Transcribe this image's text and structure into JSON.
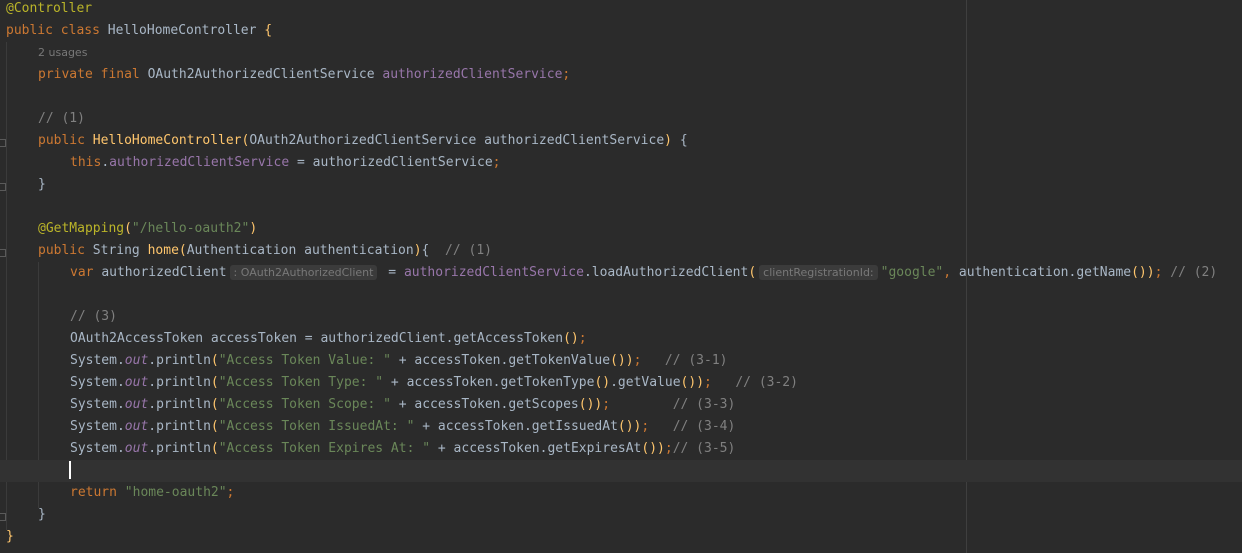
{
  "colors": {
    "background": "#2b2b2b",
    "current_line": "#323232",
    "keyword": "#cc7832",
    "annotation": "#bbb529",
    "string": "#6a8759",
    "comment": "#808080",
    "field": "#9876aa",
    "declaration": "#ffc66d",
    "default": "#a9b7c6"
  },
  "lines": [
    {
      "tokens": [
        {
          "t": "@Controller",
          "c": "annotation"
        }
      ]
    },
    {
      "tokens": [
        {
          "t": "public class ",
          "c": "keyword"
        },
        {
          "t": "HelloHomeController",
          "c": "default"
        },
        {
          "t": " {",
          "c": "paren"
        }
      ]
    },
    {
      "indent": 1,
      "usages": "2 usages",
      "tokens": []
    },
    {
      "indent": 1,
      "tokens": [
        {
          "t": "private final ",
          "c": "keyword"
        },
        {
          "t": "OAuth2AuthorizedClientService ",
          "c": "default"
        },
        {
          "t": "authorizedClientService",
          "c": "field"
        },
        {
          "t": ";",
          "c": "keyword"
        }
      ]
    },
    {
      "tokens": []
    },
    {
      "indent": 1,
      "tokens": [
        {
          "t": "// (1)",
          "c": "comment"
        }
      ]
    },
    {
      "indent": 1,
      "tokens": [
        {
          "t": "public ",
          "c": "keyword"
        },
        {
          "t": "HelloHomeController",
          "c": "decl"
        },
        {
          "t": "(",
          "c": "paren"
        },
        {
          "t": "OAuth2AuthorizedClientService authorizedClientService",
          "c": "default"
        },
        {
          "t": ")",
          "c": "paren"
        },
        {
          "t": " {",
          "c": "default"
        }
      ]
    },
    {
      "indent": 2,
      "tokens": [
        {
          "t": "this",
          "c": "keyword"
        },
        {
          "t": ".",
          "c": "default"
        },
        {
          "t": "authorizedClientService",
          "c": "field"
        },
        {
          "t": " = authorizedClientService",
          "c": "default"
        },
        {
          "t": ";",
          "c": "keyword"
        }
      ]
    },
    {
      "indent": 1,
      "tokens": [
        {
          "t": "}",
          "c": "default"
        }
      ]
    },
    {
      "tokens": []
    },
    {
      "indent": 1,
      "tokens": [
        {
          "t": "@GetMapping",
          "c": "annotation"
        },
        {
          "t": "(",
          "c": "paren"
        },
        {
          "t": "\"/hello-oauth2\"",
          "c": "string"
        },
        {
          "t": ")",
          "c": "paren"
        }
      ]
    },
    {
      "indent": 1,
      "tokens": [
        {
          "t": "public ",
          "c": "keyword"
        },
        {
          "t": "String ",
          "c": "default"
        },
        {
          "t": "home",
          "c": "decl"
        },
        {
          "t": "(",
          "c": "paren"
        },
        {
          "t": "Authentication authentication",
          "c": "default"
        },
        {
          "t": ")",
          "c": "paren"
        },
        {
          "t": "{  ",
          "c": "default"
        },
        {
          "t": "// (1)",
          "c": "comment"
        }
      ]
    },
    {
      "indent": 2,
      "tokens": [
        {
          "t": "var ",
          "c": "keyword"
        },
        {
          "t": "authorizedClient",
          "c": "default"
        },
        {
          "hint": ": OAuth2AuthorizedClient"
        },
        {
          "t": " = ",
          "c": "default"
        },
        {
          "t": "authorizedClientService",
          "c": "field"
        },
        {
          "t": ".loadAuthorizedClient",
          "c": "default"
        },
        {
          "t": "(",
          "c": "paren"
        },
        {
          "hint": "clientRegistrationId:"
        },
        {
          "t": "\"google\"",
          "c": "string"
        },
        {
          "t": ", ",
          "c": "keyword"
        },
        {
          "t": "authentication.getName",
          "c": "default"
        },
        {
          "t": "())",
          "c": "paren"
        },
        {
          "t": "; ",
          "c": "keyword"
        },
        {
          "t": "// (2)",
          "c": "comment"
        }
      ]
    },
    {
      "tokens": []
    },
    {
      "indent": 2,
      "tokens": [
        {
          "t": "// (3)",
          "c": "comment"
        }
      ]
    },
    {
      "indent": 2,
      "tokens": [
        {
          "t": "OAuth2AccessToken accessToken = authorizedClient.getAccessToken",
          "c": "default"
        },
        {
          "t": "()",
          "c": "paren"
        },
        {
          "t": ";",
          "c": "keyword"
        }
      ]
    },
    {
      "indent": 2,
      "tokens": [
        {
          "t": "System.",
          "c": "default"
        },
        {
          "t": "out",
          "c": "field-italic"
        },
        {
          "t": ".println",
          "c": "default"
        },
        {
          "t": "(",
          "c": "paren"
        },
        {
          "t": "\"Access Token Value: \"",
          "c": "string"
        },
        {
          "t": " + accessToken.getTokenValue",
          "c": "default"
        },
        {
          "t": "())",
          "c": "paren"
        },
        {
          "t": ";   ",
          "c": "keyword"
        },
        {
          "t": "// (3-1)",
          "c": "comment"
        }
      ]
    },
    {
      "indent": 2,
      "tokens": [
        {
          "t": "System.",
          "c": "default"
        },
        {
          "t": "out",
          "c": "field-italic"
        },
        {
          "t": ".println",
          "c": "default"
        },
        {
          "t": "(",
          "c": "paren"
        },
        {
          "t": "\"Access Token Type: \"",
          "c": "string"
        },
        {
          "t": " + accessToken.getTokenType",
          "c": "default"
        },
        {
          "t": "()",
          "c": "paren"
        },
        {
          "t": ".getValue",
          "c": "default"
        },
        {
          "t": "())",
          "c": "paren"
        },
        {
          "t": ";   ",
          "c": "keyword"
        },
        {
          "t": "// (3-2)",
          "c": "comment"
        }
      ]
    },
    {
      "indent": 2,
      "tokens": [
        {
          "t": "System.",
          "c": "default"
        },
        {
          "t": "out",
          "c": "field-italic"
        },
        {
          "t": ".println",
          "c": "default"
        },
        {
          "t": "(",
          "c": "paren"
        },
        {
          "t": "\"Access Token Scope: \"",
          "c": "string"
        },
        {
          "t": " + accessToken.getScopes",
          "c": "default"
        },
        {
          "t": "())",
          "c": "paren"
        },
        {
          "t": ";        ",
          "c": "keyword"
        },
        {
          "t": "// (3-3)",
          "c": "comment"
        }
      ]
    },
    {
      "indent": 2,
      "tokens": [
        {
          "t": "System.",
          "c": "default"
        },
        {
          "t": "out",
          "c": "field-italic"
        },
        {
          "t": ".println",
          "c": "default"
        },
        {
          "t": "(",
          "c": "paren"
        },
        {
          "t": "\"Access Token IssuedAt: \"",
          "c": "string"
        },
        {
          "t": " + accessToken.getIssuedAt",
          "c": "default"
        },
        {
          "t": "())",
          "c": "paren"
        },
        {
          "t": ";   ",
          "c": "keyword"
        },
        {
          "t": "// (3-4)",
          "c": "comment"
        }
      ]
    },
    {
      "indent": 2,
      "tokens": [
        {
          "t": "System.",
          "c": "default"
        },
        {
          "t": "out",
          "c": "field-italic"
        },
        {
          "t": ".println",
          "c": "default"
        },
        {
          "t": "(",
          "c": "paren"
        },
        {
          "t": "\"Access Token Expires At: \"",
          "c": "string"
        },
        {
          "t": " + accessToken.getExpiresAt",
          "c": "default"
        },
        {
          "t": "())",
          "c": "paren"
        },
        {
          "t": ";",
          "c": "keyword"
        },
        {
          "t": "// (3-5)",
          "c": "comment"
        }
      ]
    },
    {
      "current": true,
      "tokens": []
    },
    {
      "indent": 2,
      "tokens": [
        {
          "t": "return ",
          "c": "keyword"
        },
        {
          "t": "\"home-oauth2\"",
          "c": "string"
        },
        {
          "t": ";",
          "c": "keyword"
        }
      ]
    },
    {
      "indent": 1,
      "tokens": [
        {
          "t": "}",
          "c": "default"
        }
      ]
    },
    {
      "tokens": [
        {
          "t": "}",
          "c": "paren"
        }
      ]
    }
  ]
}
